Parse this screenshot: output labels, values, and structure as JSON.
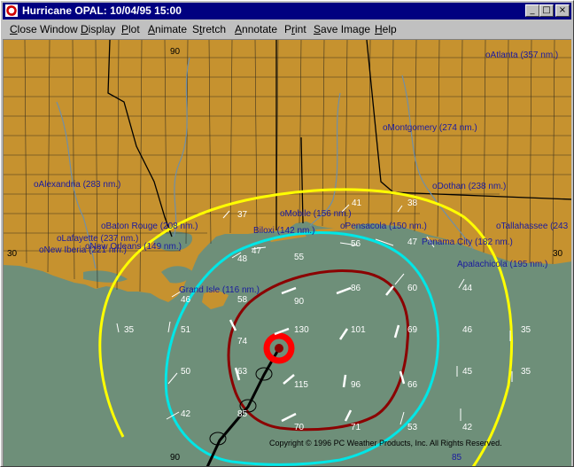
{
  "window": {
    "title": "Hurricane OPAL: 10/04/95 15:00",
    "controls": {
      "minimize": "_",
      "maximize": "□",
      "close": "×"
    }
  },
  "menu": {
    "items": [
      {
        "id": "close_window",
        "label": "Close Window",
        "underline_index": 0
      },
      {
        "id": "display",
        "label": "Display",
        "underline_index": 0
      },
      {
        "id": "plot",
        "label": "Plot",
        "underline_index": 0
      },
      {
        "id": "animate",
        "label": "Animate",
        "underline_index": 0
      },
      {
        "id": "stretch",
        "label": "Stretch",
        "underline_index": 1
      },
      {
        "id": "annotate",
        "label": "Annotate",
        "underline_index": 0
      },
      {
        "id": "print",
        "label": "Print",
        "underline_index": 1
      },
      {
        "id": "save_image",
        "label": "Save Image",
        "underline_index": 0
      },
      {
        "id": "help",
        "label": "Help",
        "underline_index": 0
      }
    ]
  },
  "map": {
    "colors": {
      "water": "#6e8f79",
      "land": "#c6922f",
      "county_lines": "#1a1a1a",
      "rivers": "#6f8fa8",
      "ring_outer": "#ffff00",
      "ring_middle": "#00e6e6",
      "ring_inner": "#8b0000",
      "eye": "#ff0000",
      "city_label": "#1a1aa0",
      "wind_value": "#ffffff"
    },
    "longitude_labels": [
      "90",
      "85"
    ],
    "latitude_labels": [
      "30",
      "30"
    ],
    "cities": [
      "oAtlanta (357 nm.)",
      "oMontgomery (274 nm.)",
      "oAlexandria (283 nm.)",
      "oDothan (238 nm.)",
      "oMobile (156 nm.)",
      "oTallahassee (243",
      "oBaton Rouge (208 nm.)",
      "Biloxi (142 nm.)",
      "oPensacola (150 nm.)",
      "Panama City (182 nm.)",
      "oLafayette (237 nm.)",
      "oNew Orleans (149 nm.)",
      "Apalachicola (195 nm.)",
      "oNew Iberia (221 nm.)",
      "Grand Isle (116 nm.)"
    ],
    "wind_values": [
      "37",
      "41",
      "38",
      "47",
      "56",
      "47",
      "48",
      "55",
      "60",
      "44",
      "46",
      "58",
      "90",
      "86",
      "69",
      "35",
      "51",
      "74",
      "130",
      "101",
      "46",
      "35",
      "50",
      "63",
      "115",
      "96",
      "66",
      "45",
      "35",
      "42",
      "85",
      "70",
      "71",
      "53",
      "42"
    ],
    "copyright": "Copyright © 1996 PC Weather Products, Inc. All Rights Reserved."
  }
}
